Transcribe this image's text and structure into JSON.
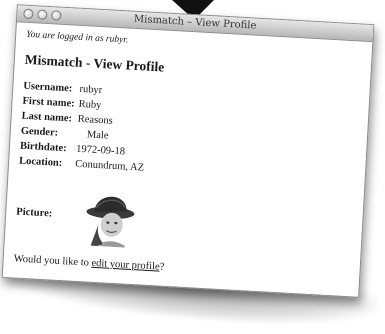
{
  "window": {
    "title": "Mismatch – View Profile"
  },
  "status": {
    "logged_in_text": "You are logged in as rubyr."
  },
  "page": {
    "title": "Mismatch - View Profile"
  },
  "profile": {
    "fields": [
      {
        "label": "Username:",
        "value": "rubyr"
      },
      {
        "label": "First name:",
        "value": "Ruby"
      },
      {
        "label": "Last name:",
        "value": "Reasons"
      },
      {
        "label": "Gender:",
        "value": "Male"
      },
      {
        "label": "Birthdate:",
        "value": "1972-09-18"
      },
      {
        "label": "Location:",
        "value": "Conundrum, AZ"
      }
    ],
    "picture_label": "Picture:"
  },
  "footer": {
    "prefix": "Would you like to ",
    "link": "edit your profile",
    "suffix": "?"
  }
}
